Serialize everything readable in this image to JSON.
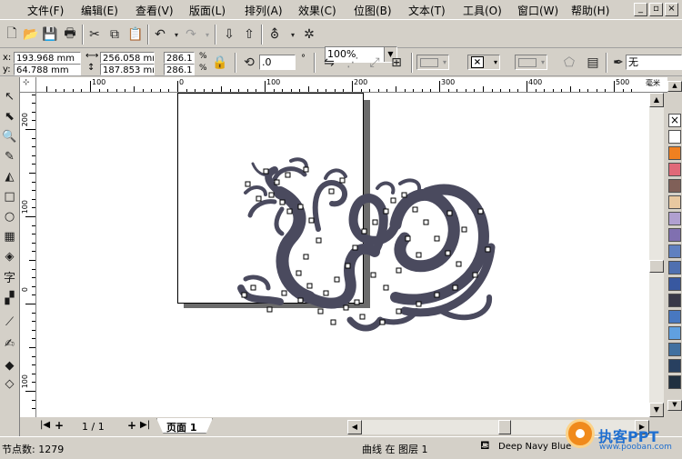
{
  "menu": {
    "items": [
      "文件(F)",
      "编辑(E)",
      "查看(V)",
      "版面(L)",
      "排列(A)",
      "效果(C)",
      "位图(B)",
      "文本(T)",
      "工具(O)",
      "窗口(W)",
      "帮助(H)"
    ]
  },
  "toolbar": {
    "zoom_value": "100%"
  },
  "property_bar": {
    "x_label": "x:",
    "x_value": "193.968 mm",
    "y_label": "y:",
    "y_value": "64.788 mm",
    "width_value": "256.058 mr",
    "height_value": "187.853 mr",
    "scale_x": "286.1",
    "scale_y": "286.1",
    "percent": "%",
    "rotation_value": ".0",
    "degree": "°",
    "outline_value": "无"
  },
  "rulers": {
    "h_labels": [
      "100",
      "0",
      "100",
      "200",
      "300",
      "400",
      "500"
    ],
    "v_labels": [
      "200",
      "100",
      "0",
      "100"
    ],
    "unit_label": "毫米"
  },
  "page_bar": {
    "page_count": "1 / 1",
    "page_tab": "页面 1"
  },
  "status": {
    "node_count": "节点数: 1279",
    "object_info": "曲线 在 图层 1",
    "fill_name": "Deep Navy Blue"
  },
  "watermark": {
    "brand": "执客PPT",
    "url": "www.pooban.com"
  },
  "colors": {
    "dragon": "#4a4a5e",
    "palette": [
      "#ffffff",
      "#f08020",
      "#e06878",
      "#806058",
      "#e8c8a0",
      "#b0a0d0",
      "#8070b0",
      "#6080c0",
      "#5070b0",
      "#3858a0",
      "#383848",
      "#4878c0",
      "#60a0e0",
      "#4070a0",
      "#284060",
      "#203040"
    ]
  }
}
